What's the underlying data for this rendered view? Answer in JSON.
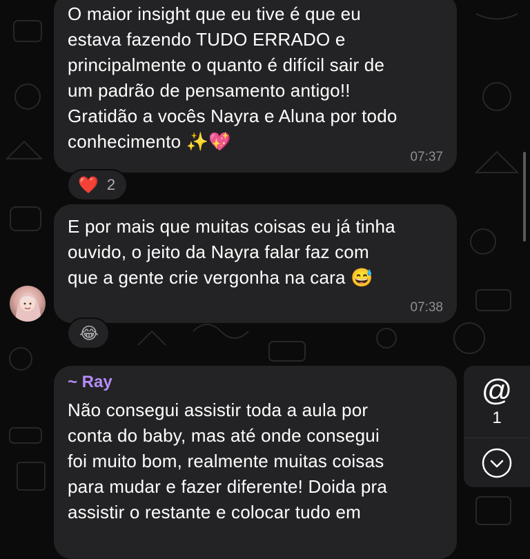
{
  "messages": [
    {
      "text": "O maior insight que eu tive é que eu\nestava fazendo TUDO ERRADO e\nprincipalmente o quanto é difícil sair de\num padrão de pensamento antigo!!\nGratidão a vocês Nayra e Aluna por todo\nconhecimento ✨💖",
      "time": "07:37",
      "reaction": {
        "emoji": "❤️",
        "count": "2"
      }
    },
    {
      "text": "E por mais que muitas coisas eu já tinha\nouvido, o jeito da Nayra falar faz com\nque a gente crie vergonha na cara 😅",
      "time": "07:38",
      "reaction": {
        "emoji": "😂",
        "count": ""
      }
    },
    {
      "sender": "~ Ray",
      "text": "Não consegui assistir toda a aula por\nconta do baby, mas até onde consegui\nfoi muito bom, realmente muitas coisas\npara mudar e fazer diferente! Doida pra\nassistir o restante e colocar tudo em"
    }
  ],
  "side_panel": {
    "mention_symbol": "@",
    "mention_count": "1"
  },
  "colors": {
    "bubble": "#232325",
    "sender": "#b58cf5",
    "background": "#0b0b0b"
  },
  "icons": [
    "avatar",
    "mention-icon",
    "chevron-down-icon"
  ]
}
